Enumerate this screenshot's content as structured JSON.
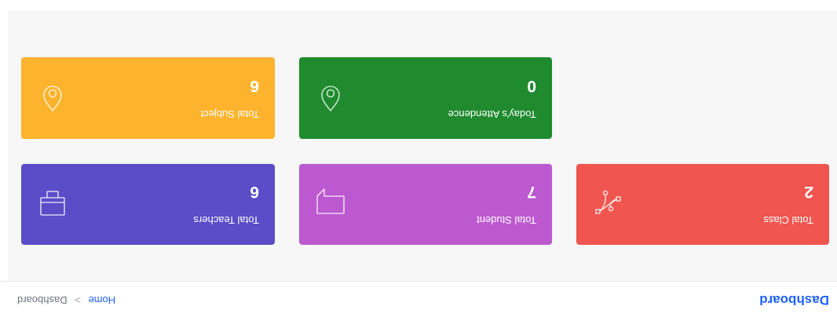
{
  "header": {
    "title": "Dashboard",
    "breadcrumb": {
      "home": "Home",
      "separator": ">",
      "current": "Dashboard"
    }
  },
  "cards": [
    {
      "label": "Total Class",
      "value": "2",
      "color": "#f0554f",
      "icon": "vector-bezier-icon"
    },
    {
      "label": "Total Student",
      "value": "7",
      "color": "#bd59d0",
      "icon": "chat-bubble-icon"
    },
    {
      "label": "Total Teachers",
      "value": "6",
      "color": "#5b4cc7",
      "icon": "monitor-icon"
    },
    {
      "label": "Today's Attendence",
      "value": "0",
      "color": "#1f8a2e",
      "icon": "drop-icon"
    },
    {
      "label": "Total Subject",
      "value": "6",
      "color": "#fdb32d",
      "icon": "drop-icon"
    }
  ]
}
